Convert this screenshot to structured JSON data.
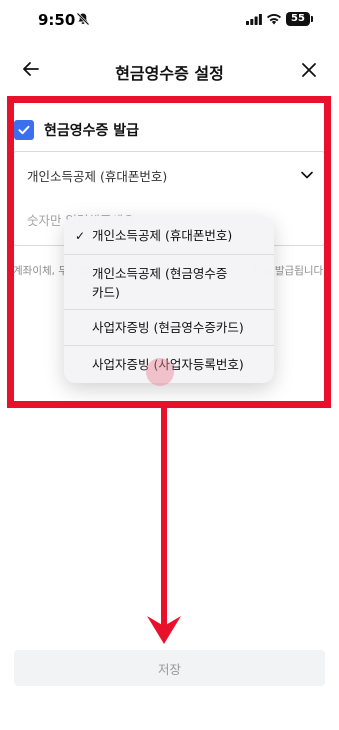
{
  "status_bar": {
    "time": "9:50",
    "battery": "55"
  },
  "header": {
    "title": "현금영수증 설정"
  },
  "receipt": {
    "checkbox_label": "현금영수증 발급",
    "checked": true,
    "select_value": "개인소득공제 (휴대폰번호)",
    "input_placeholder": "숫자만 입력해주세요",
    "helper_text": "계좌이체, 무통장입금 등 현금성 결제 시 현금영수증이 자동 발급됩니다"
  },
  "dropdown": {
    "check_mark": "✓",
    "options": [
      {
        "label": "개인소득공제 (휴대폰번호)",
        "selected": true
      },
      {
        "label": "개인소득공제 (현금영수증\n카드)",
        "selected": false
      },
      {
        "label": "사업자증빙 (현금영수증카드)",
        "selected": false
      },
      {
        "label": "사업자증빙 (사업자등록번호)",
        "selected": false
      }
    ]
  },
  "footer": {
    "save_label": "저장"
  },
  "colors": {
    "accent": "#3b6ff0",
    "annotation": "#e8102a"
  }
}
